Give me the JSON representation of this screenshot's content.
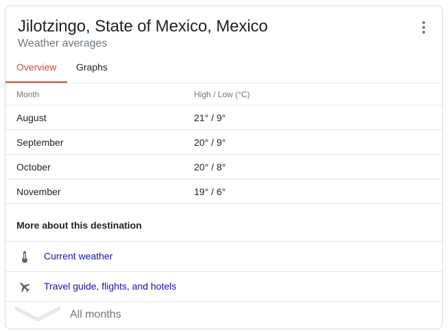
{
  "header": {
    "title": "Jilotzingo, State of Mexico, Mexico",
    "subtitle": "Weather averages",
    "more_options_icon": "more-vert-icon"
  },
  "tabs": [
    {
      "label": "Overview",
      "active": true
    },
    {
      "label": "Graphs",
      "active": false
    }
  ],
  "table": {
    "columns": [
      "Month",
      "High / Low  (°C)"
    ],
    "rows": [
      {
        "month": "August",
        "value": "21° / 9°"
      },
      {
        "month": "September",
        "value": "20° / 9°"
      },
      {
        "month": "October",
        "value": "20° / 8°"
      },
      {
        "month": "November",
        "value": "19° / 6°"
      }
    ]
  },
  "more_about": {
    "heading": "More about this destination",
    "links": [
      {
        "label": "Current weather",
        "icon": "thermometer-icon"
      },
      {
        "label": "Travel guide, flights, and hotels",
        "icon": "airplane-icon"
      }
    ]
  },
  "footer": {
    "expand_label": "All months",
    "icon": "chevron-down-icon"
  },
  "colors": {
    "accent": "#d14836",
    "link": "#1a0dab",
    "muted": "#70757a",
    "text": "#222222",
    "border": "#dadce0"
  }
}
